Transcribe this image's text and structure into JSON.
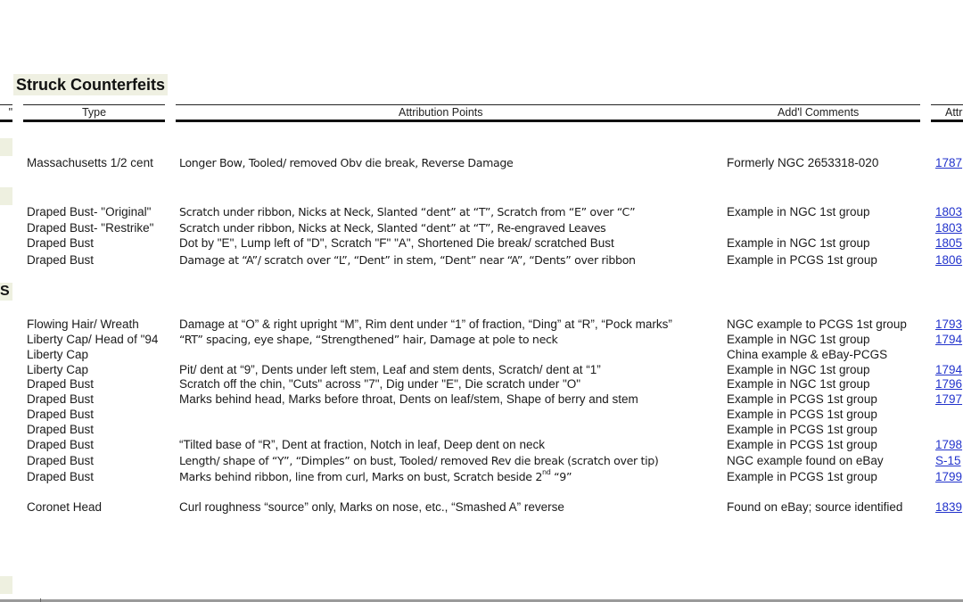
{
  "document": {
    "section_title": "Struck Counterfeits",
    "left_header_fragment": "\"",
    "left_section_fragment": "S"
  },
  "table": {
    "columns": [
      "Type",
      "Attribution Points",
      "Add'l Comments",
      "Attr"
    ],
    "rows": [
      {
        "type": "Massachusetts 1/2 cent",
        "attribution": "Longer Bow, Tooled/ removed Obv die break, Reverse Damage",
        "comments": "Formerly NGC 2653318-020",
        "link": "1787"
      },
      {
        "type": "Draped Bust- \"Original\"",
        "attribution": "Scratch under ribbon, Nicks at Neck, Slanted “dent” at “T”, Scratch from “E” over “C”",
        "comments": "Example in NGC 1st group",
        "link": "1803"
      },
      {
        "type": "Draped Bust- \"Restrike\"",
        "attribution": "Scratch under ribbon, Nicks at Neck, Slanted “dent” at “T”, Re-engraved Leaves",
        "comments": "",
        "link": "1803"
      },
      {
        "type": "Draped Bust",
        "attribution": "Dot by \"E\", Lump left of \"D\", Scratch \"F\" \"A\", Shortened Die break/ scratched Bust",
        "comments": "Example in NGC 1st group",
        "link": "1805"
      },
      {
        "type": "Draped Bust",
        "attribution": "Damage at “A”/ scratch over “L”, “Dent” in stem, “Dent” near “A”, “Dents” over ribbon",
        "comments": "Example in PCGS 1st group",
        "link": "1806"
      },
      {
        "type": "Flowing Hair/ Wreath",
        "attribution": "Damage at “O” & right upright “M”, Rim dent under “1” of fraction, “Ding” at “R”, “Pock marks”",
        "comments": "NGC example to PCGS 1st group",
        "link": "1793"
      },
      {
        "type": "Liberty Cap/ Head of \"94",
        "attribution": "“RT” spacing, eye shape, “Strengthened” hair, Damage at pole to neck",
        "comments": "Example in NGC 1st group",
        "link": "1794"
      },
      {
        "type": "Liberty Cap",
        "attribution": "",
        "comments": "China example & eBay-PCGS",
        "link": ""
      },
      {
        "type": "Liberty Cap",
        "attribution": "Pit/ dent at “9”, Dents under left stem, Leaf and stem dents, Scratch/ dent at “1”",
        "comments": "Example in NGC 1st group",
        "link": "1794"
      },
      {
        "type": "Draped Bust",
        "attribution": "Scratch off the chin, \"Cuts\" across \"7\", Dig under \"E\", Die scratch under \"O\"",
        "comments": "Example in NGC 1st group",
        "link": "1796"
      },
      {
        "type": "Draped Bust",
        "attribution": "Marks behind head, Marks before throat, Dents on leaf/stem, Shape of berry and stem",
        "comments": "Example in PCGS 1st group",
        "link": "1797"
      },
      {
        "type": "Draped Bust",
        "attribution": "",
        "comments": "Example in PCGS 1st group",
        "link": ""
      },
      {
        "type": "Draped Bust",
        "attribution": "",
        "comments": "Example in PCGS 1st group",
        "link": ""
      },
      {
        "type": "Draped Bust",
        "attribution": "“Tilted base of “R”, Dent at fraction, Notch in leaf, Deep dent on neck",
        "comments": "Example in PCGS 1st group",
        "link": "1798"
      },
      {
        "type": "Draped Bust",
        "attribution": "Length/ shape of “Y”, “Dimples” on bust, Tooled/ removed Rev die break (scratch over tip)",
        "comments": "NGC example found on eBay",
        "link": "S-15"
      },
      {
        "type": "Draped Bust",
        "attribution_pre": "Marks behind ribbon, line from curl, Marks on bust, Scratch beside 2",
        "attribution_sup": "nd",
        "attribution_post": " “9”",
        "comments": "Example in PCGS 1st group",
        "link": "1799"
      },
      {
        "type": "Coronet Head",
        "attribution": "Curl roughness “source” only, Marks on nose, etc., “Smashed A” reverse",
        "comments": "Found on eBay; source identified",
        "link": "1839"
      }
    ]
  }
}
